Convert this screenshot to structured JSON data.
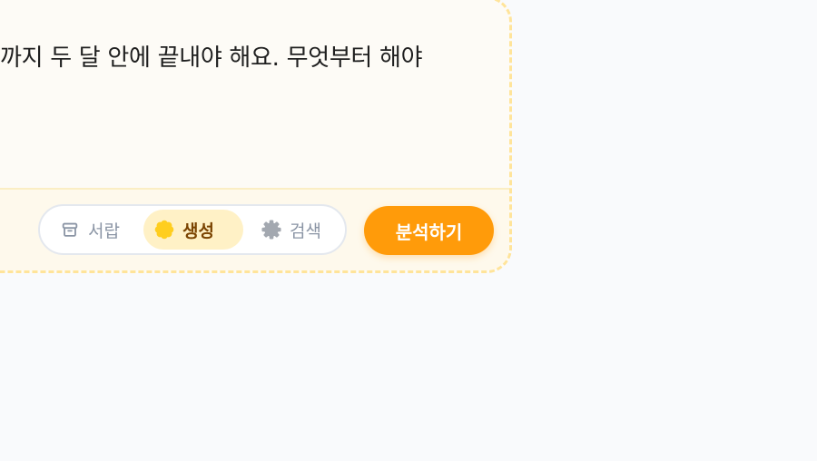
{
  "prompt": {
    "text": "까지 두 달 안에 끝내야 해요. 무엇부터 해야"
  },
  "modes": {
    "drawer": {
      "label": "서랍",
      "icon": "archive-box-icon"
    },
    "generate": {
      "label": "생성",
      "icon": "sun-flower-icon",
      "selected": true
    },
    "search": {
      "label": "검색",
      "icon": "gear-icon"
    }
  },
  "actions": {
    "analyze_label": "분석하기"
  },
  "colors": {
    "accent": "#ff9b0a",
    "selected_bg": "#fff1c6",
    "selected_text": "#7a4300",
    "card_border": "#ffe49a",
    "muted_text": "#8b95a5"
  }
}
